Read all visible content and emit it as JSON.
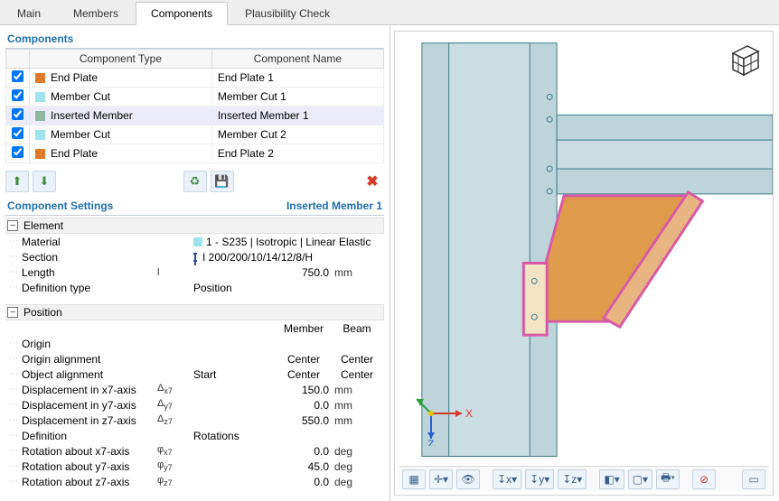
{
  "tabs": {
    "main": "Main",
    "members": "Members",
    "components": "Components",
    "plaus": "Plausibility Check"
  },
  "components_title": "Components",
  "component_headers": {
    "type": "Component Type",
    "name": "Component Name"
  },
  "components": [
    {
      "checked": true,
      "swatch": "#e07a2a",
      "type": "End Plate",
      "name": "End Plate 1"
    },
    {
      "checked": true,
      "swatch": "#9ee3ee",
      "type": "Member Cut",
      "name": "Member Cut 1"
    },
    {
      "checked": true,
      "swatch": "#8fb8a0",
      "type": "Inserted Member",
      "name": "Inserted Member 1",
      "selected": true
    },
    {
      "checked": true,
      "swatch": "#9ee3ee",
      "type": "Member Cut",
      "name": "Member Cut 2"
    },
    {
      "checked": true,
      "swatch": "#e07a2a",
      "type": "End Plate",
      "name": "End Plate 2"
    }
  ],
  "minibar": {
    "move_up": "↥",
    "move_down": "↧",
    "refresh": "⟳",
    "save": "💾",
    "delete": "✕"
  },
  "settings_title": "Component Settings",
  "settings_subject": "Inserted Member 1",
  "groups": {
    "element": "Element",
    "position": "Position"
  },
  "element": {
    "material_label": "Material",
    "material_value": "1 - S235 | Isotropic | Linear Elastic",
    "section_label": "Section",
    "section_value": "I 200/200/10/14/12/8/H",
    "length_label": "Length",
    "length_sym": "l",
    "length_value": "750.0",
    "length_unit": "mm",
    "deftype_label": "Definition type",
    "deftype_value": "Position"
  },
  "position": {
    "head_member": "Member",
    "head_beam": "Beam",
    "origin_label": "Origin",
    "origin_alignment_label": "Origin alignment",
    "origin_alignment_member": "Center",
    "origin_alignment_beam": "Center",
    "object_alignment_label": "Object alignment",
    "object_alignment_c1": "Start",
    "object_alignment_member": "Center",
    "object_alignment_beam": "Center",
    "disp_x_label": "Displacement in x7-axis",
    "disp_x_sym": "Δx7",
    "disp_x_val": "150.0",
    "disp_x_unit": "mm",
    "disp_y_label": "Displacement in y7-axis",
    "disp_y_sym": "Δy7",
    "disp_y_val": "0.0",
    "disp_y_unit": "mm",
    "disp_z_label": "Displacement in z7-axis",
    "disp_z_sym": "Δz7",
    "disp_z_val": "550.0",
    "disp_z_unit": "mm",
    "definition_label": "Definition",
    "definition_val": "Rotations",
    "rot_x_label": "Rotation about x7-axis",
    "rot_x_sym": "φx7",
    "rot_x_val": "0.0",
    "rot_x_unit": "deg",
    "rot_y_label": "Rotation about y7-axis",
    "rot_y_sym": "φy7",
    "rot_y_val": "45.0",
    "rot_y_unit": "deg",
    "rot_z_label": "Rotation about z7-axis",
    "rot_z_sym": "φz7",
    "rot_z_val": "0.0",
    "rot_z_unit": "deg"
  },
  "axes": {
    "x": "X",
    "z": "Z"
  }
}
